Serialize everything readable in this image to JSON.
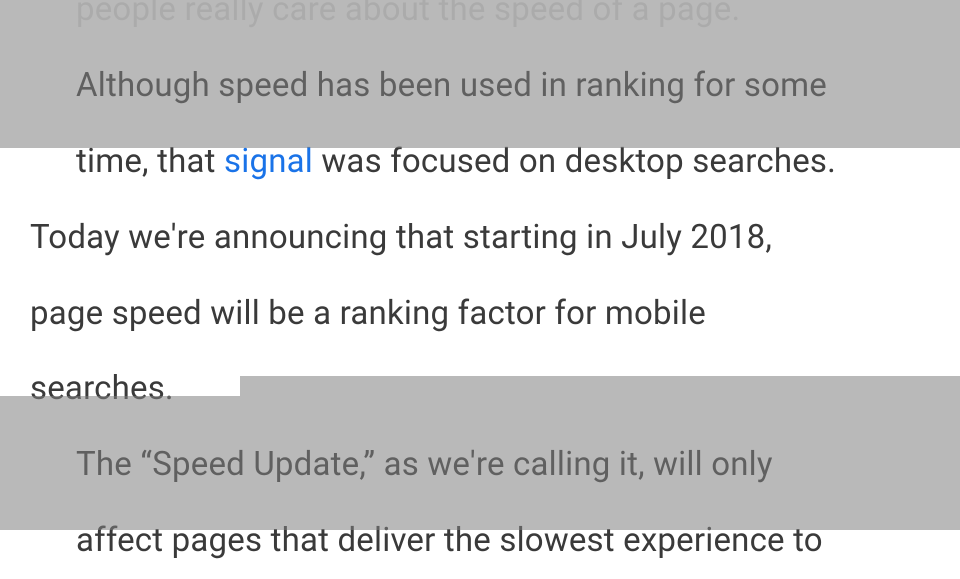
{
  "article": {
    "line_cut": "people really care about the speed of a page.",
    "line1_prefix": "Although speed has been ",
    "line1_link_pre": "used",
    "line1_mid": " in ranking for some",
    "line2_prefix": "time, that ",
    "link_text": "signal",
    "line2_suffix": " was focused on desktop searches.",
    "highlight_part1": "Today we're announcing that starting in July 2018,",
    "highlight_part2": "page speed will be a ranking factor for mobile",
    "highlight_part3": "searches.",
    "line6": "The “Speed Update,” as we're calling it, will only",
    "line7": "affect pages that deliver the slowest experience to"
  }
}
